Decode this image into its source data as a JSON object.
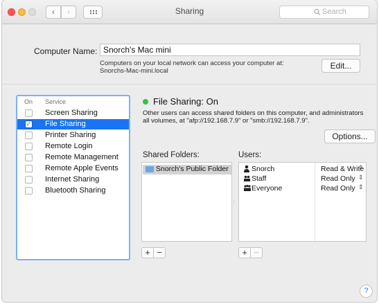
{
  "window": {
    "title": "Sharing",
    "search_placeholder": "Search",
    "nav_back": "‹",
    "nav_forward": "›"
  },
  "computer_name": {
    "label": "Computer Name:",
    "value": "Snorch's Mac mini",
    "desc_line1": "Computers on your local network can access your computer at:",
    "desc_line2": "Snorchs-Mac-mini.local",
    "edit_button": "Edit..."
  },
  "services": {
    "header_on": "On",
    "header_service": "Service",
    "items": [
      {
        "label": "Screen Sharing",
        "checked": false,
        "selected": false
      },
      {
        "label": "File Sharing",
        "checked": true,
        "selected": true
      },
      {
        "label": "Printer Sharing",
        "checked": false,
        "selected": false
      },
      {
        "label": "Remote Login",
        "checked": false,
        "selected": false
      },
      {
        "label": "Remote Management",
        "checked": false,
        "selected": false
      },
      {
        "label": "Remote Apple Events",
        "checked": false,
        "selected": false
      },
      {
        "label": "Internet Sharing",
        "checked": false,
        "selected": false
      },
      {
        "label": "Bluetooth Sharing",
        "checked": false,
        "selected": false
      }
    ]
  },
  "file_sharing": {
    "status": "File Sharing: On",
    "status_color": "#2bc840",
    "desc_line1": "Other users can access shared folders on this computer, and administrators",
    "desc_line2": "all volumes, at \"afp://192.168.7.9\" or \"smb://192.168.7.9\".",
    "options_button": "Options..."
  },
  "shared_folders": {
    "header": "Shared Folders:",
    "items": [
      {
        "label": "Snorch's Public Folder"
      }
    ],
    "add": "+",
    "remove": "−"
  },
  "users": {
    "header": "Users:",
    "items": [
      {
        "name": "Snorch",
        "permission": "Read & Write",
        "icon": "user-icon"
      },
      {
        "name": "Staff",
        "permission": "Read Only",
        "icon": "group-icon"
      },
      {
        "name": "Everyone",
        "permission": "Read Only",
        "icon": "everyone-icon"
      }
    ],
    "add": "+",
    "remove": "−"
  },
  "help": "?"
}
